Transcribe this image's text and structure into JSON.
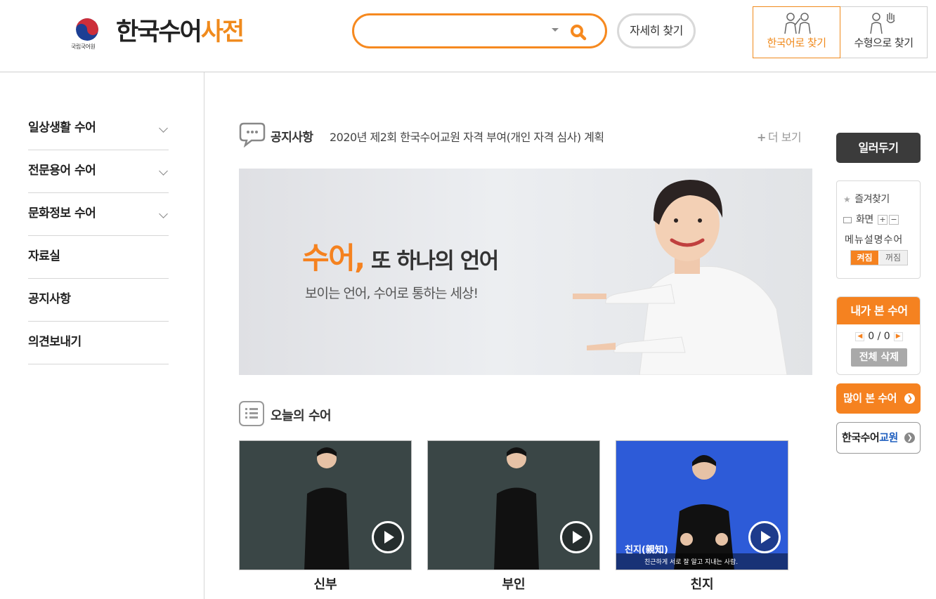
{
  "header": {
    "institution": "국립국어원",
    "title_main": "한국수어",
    "title_accent": "사전",
    "search": {
      "value": "",
      "placeholder": ""
    },
    "detail_search_label": "자세히 찾기",
    "find_by_korean_label": "한국어로 찾기",
    "find_by_shape_label": "수형으로 찾기"
  },
  "sidebar": {
    "items": [
      {
        "label": "일상생활 수어",
        "expandable": true
      },
      {
        "label": "전문용어 수어",
        "expandable": true
      },
      {
        "label": "문화정보 수어",
        "expandable": true
      },
      {
        "label": "자료실",
        "expandable": false
      },
      {
        "label": "공지사항",
        "expandable": false
      },
      {
        "label": "의견보내기",
        "expandable": false
      }
    ]
  },
  "notice": {
    "label": "공지사항",
    "text": "2020년 제2회 한국수어교원 자격 부여(개인 자격 심사) 계획",
    "more_label": "더 보기"
  },
  "banner": {
    "headline_accent": "수어,",
    "headline_rest": " 또 하나의 언어",
    "subtext": "보이는 언어, 수어로 통하는 세상!"
  },
  "today": {
    "label": "오늘의 수어",
    "videos": [
      {
        "caption": "신부"
      },
      {
        "caption": "부인"
      },
      {
        "caption": "친지",
        "overlay_title": "친지(親知)",
        "overlay_desc": "친근하게 서로 잘 알고 지내는 사람."
      }
    ]
  },
  "rail": {
    "title": "일러두기",
    "favorites_label": "즐겨찾기",
    "screen_label": "화면",
    "zoom_in": "+",
    "zoom_out": "−",
    "menu_desc_label": "메뉴설명수어",
    "toggle_on": "켜짐",
    "toggle_off": "꺼짐",
    "viewed_title": "내가 본 수어",
    "viewed_count": "0 / 0",
    "clear_all_label": "전체 삭제",
    "popular_label": "많이 본 수어",
    "teacher_label_prefix": "한국수어",
    "teacher_label_accent": "교원"
  },
  "colors": {
    "accent": "#f58220",
    "dark": "#3b3b3b",
    "teacher_blue": "#1f5fbf",
    "video_bg": "#3a4646",
    "video_bg_blue": "#2d5bd8"
  }
}
